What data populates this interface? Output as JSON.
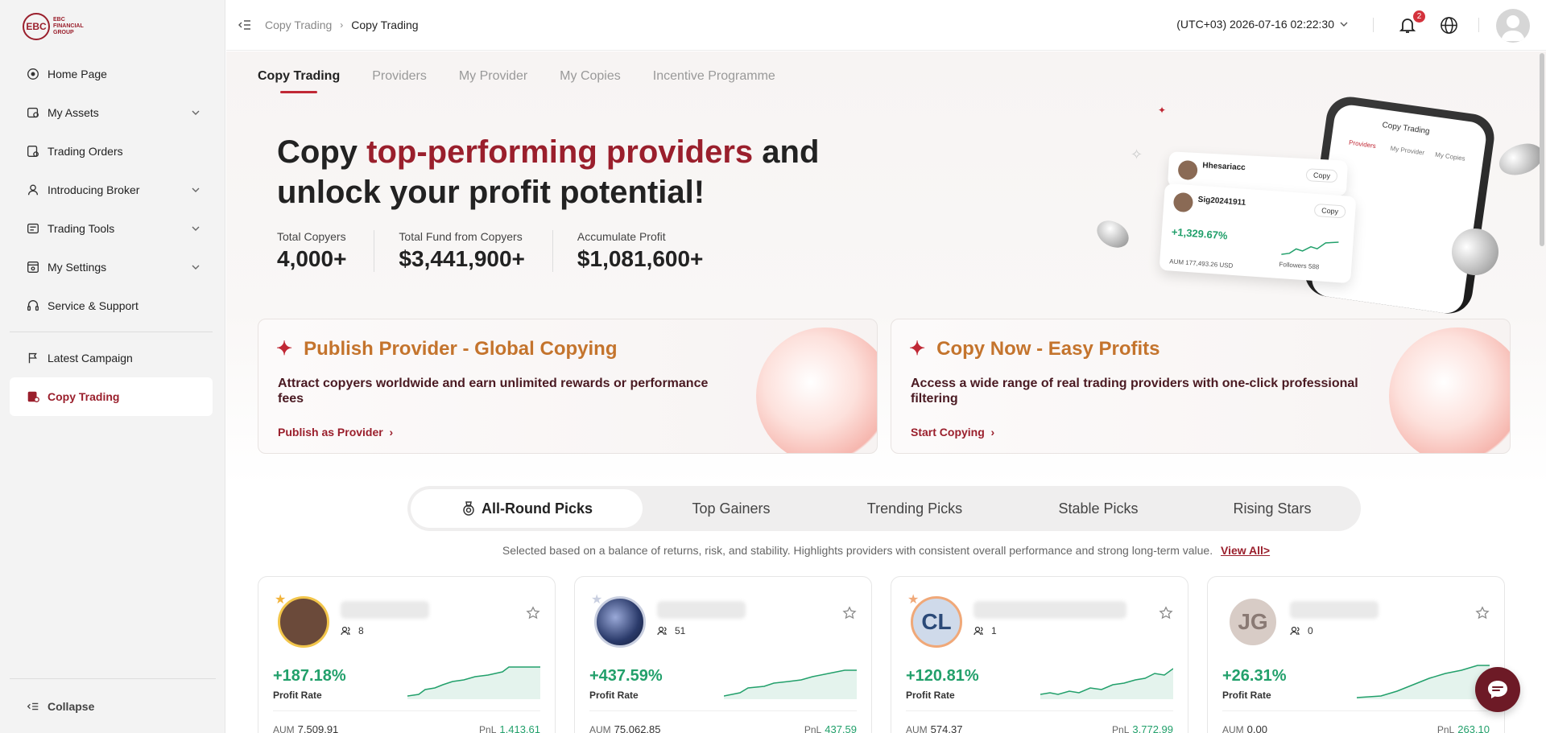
{
  "brand": {
    "mark": "EBC",
    "line1": "EBC",
    "line2": "FINANCIAL",
    "line3": "GROUP"
  },
  "sidebar": {
    "items": [
      {
        "label": "Home Page",
        "icon": "home-icon",
        "expandable": false
      },
      {
        "label": "My Assets",
        "icon": "wallet-icon",
        "expandable": true
      },
      {
        "label": "Trading Orders",
        "icon": "orders-icon",
        "expandable": false
      },
      {
        "label": "Introducing Broker",
        "icon": "user-icon",
        "expandable": true
      },
      {
        "label": "Trading Tools",
        "icon": "tools-icon",
        "expandable": true
      },
      {
        "label": "My Settings",
        "icon": "settings-icon",
        "expandable": true
      },
      {
        "label": "Service & Support",
        "icon": "headset-icon",
        "expandable": false
      },
      {
        "label": "Latest Campaign",
        "icon": "flag-icon",
        "expandable": false
      },
      {
        "label": "Copy Trading",
        "icon": "copy-trading-icon",
        "expandable": false,
        "active": true
      }
    ],
    "collapse_label": "Collapse"
  },
  "header": {
    "breadcrumb": [
      "Copy Trading",
      "Copy Trading"
    ],
    "timezone": "(UTC+03)  2026-07-16 02:22:30",
    "notification_count": "2"
  },
  "tabs": [
    "Copy Trading",
    "Providers",
    "My Provider",
    "My Copies",
    "Incentive Programme"
  ],
  "hero": {
    "title_pre": "Copy ",
    "title_highlight": "top-performing providers",
    "title_post": " and unlock your profit potential!",
    "stats": [
      {
        "label": "Total Copyers",
        "value": "4,000+"
      },
      {
        "label": "Total Fund from Copyers",
        "value": "$3,441,900+"
      },
      {
        "label": "Accumulate Profit",
        "value": "$1,081,600+"
      }
    ],
    "phone": {
      "title": "Copy Trading",
      "tabs": [
        "Providers",
        "My Provider",
        "My Copies"
      ],
      "card1_name": "Hhesariacc",
      "card2_name": "Sig20241911",
      "copy_label": "Copy",
      "pct": "+1,329.67%",
      "aum": "AUM 177,493.26 USD",
      "followers": "Followers 588"
    }
  },
  "promos": [
    {
      "title": "Publish Provider - Global Copying",
      "desc": "Attract copyers worldwide and earn unlimited rewards or performance fees",
      "link": "Publish as Provider"
    },
    {
      "title": "Copy Now - Easy Profits",
      "desc": "Access a wide range of real trading providers with one-click professional filtering",
      "link": "Start Copying"
    }
  ],
  "picks": {
    "tabs": [
      "All-Round Picks",
      "Top Gainers",
      "Trending Picks",
      "Stable Picks",
      "Rising Stars"
    ],
    "desc": "Selected based on a balance of returns, risk, and stability. Highlights providers with consistent overall performance and strong long-term value.",
    "view_all": "View All>"
  },
  "providers": [
    {
      "initials": "",
      "followers": "8",
      "profit": "+187.18%",
      "profit_label": "Profit Rate",
      "aum_label": "AUM",
      "aum": "7,509.91",
      "pnl_label": "PnL",
      "pnl": "1,413.61",
      "avatar_color": "#6b4a3a",
      "border": "#f2c54a"
    },
    {
      "initials": "",
      "followers": "51",
      "profit": "+437.59%",
      "profit_label": "Profit Rate",
      "aum_label": "AUM",
      "aum": "75,062.85",
      "pnl_label": "PnL",
      "pnl": "437.59",
      "avatar_color": "#2a3a6a",
      "border": "#c9cfe0"
    },
    {
      "initials": "CL",
      "followers": "1",
      "profit": "+120.81%",
      "profit_label": "Profit Rate",
      "aum_label": "AUM",
      "aum": "574.37",
      "pnl_label": "PnL",
      "pnl": "3,772.99",
      "avatar_color": "#cfdaea",
      "border": "#f0a878"
    },
    {
      "initials": "JG",
      "followers": "0",
      "profit": "+26.31%",
      "profit_label": "Profit Rate",
      "aum_label": "AUM",
      "aum": "0.00",
      "pnl_label": "PnL",
      "pnl": "263.10",
      "avatar_color": "#d8ccc6",
      "border": "#ffffff"
    }
  ],
  "colors": {
    "accent": "#9a1f2c",
    "positive": "#22a06b",
    "promo_title": "#c4742d"
  }
}
